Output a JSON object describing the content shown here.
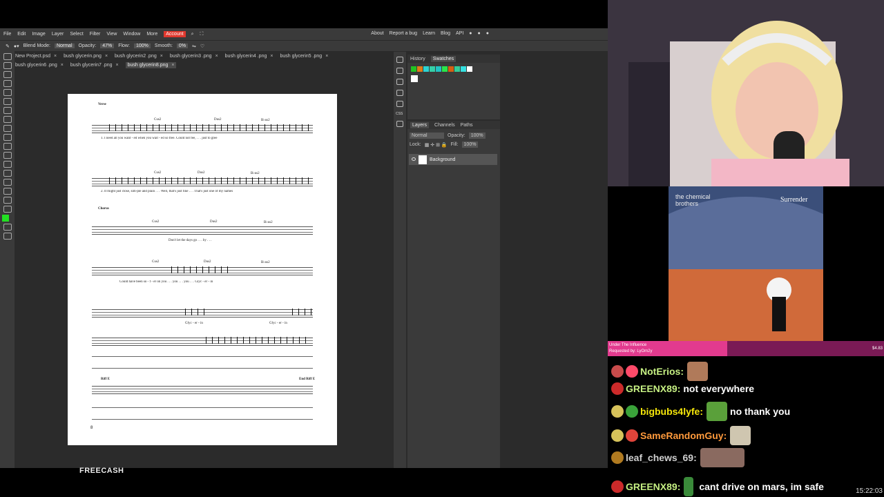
{
  "menubar": {
    "items": [
      "File",
      "Edit",
      "Image",
      "Layer",
      "Select",
      "Filter",
      "View",
      "Window",
      "More"
    ],
    "account": "Account",
    "right_items": [
      "About",
      "Report a bug",
      "Learn",
      "Blog",
      "API"
    ]
  },
  "options": {
    "blend_mode_label": "Blend Mode:",
    "blend_mode_value": "Normal",
    "opacity_label": "Opacity:",
    "opacity_value": "47%",
    "flow_label": "Flow:",
    "flow_value": "100%",
    "smooth_label": "Smooth:",
    "smooth_value": "0%"
  },
  "tabs": {
    "row1": [
      "New Project.psd",
      "bush glycerin.png",
      "bush glycerin2 .png",
      "bush glycerin3 .png",
      "bush glycerin4 .png",
      "bush glycerin5 .png"
    ],
    "row2": [
      "bush glycerin6 .png",
      "bush glycerin7 .png",
      "bush glycerin8.png"
    ],
    "close": "×"
  },
  "sheet": {
    "verse": "Verse",
    "chorus": "Chorus",
    "chords1": [
      "Cus2",
      "Dus2",
      "B♭us2"
    ],
    "lyric1": "1. I need all you want - ed   when you wait - ed   so   free.   Could not   fee, . . .   just   to   gree",
    "lyric2": "2. It might just   close, sim-ple and plain . . .   Well, that's just   fine . . .   That's just one of my   names",
    "lyric3": "Don't let   the   days   go . . .   by . . .",
    "lyric4": "Could have been   so   -   f   -   er   on   you . . .   you . . .   you . . .   Glyc - er - in",
    "lyric5": "Glyc - er - in",
    "riff_a": "Riff E",
    "riff_b": "End Riff E",
    "page_number": "8"
  },
  "panels": {
    "history": "History",
    "swatches": "Swatches",
    "layers": "Layers",
    "channels": "Channels",
    "paths": "Paths",
    "layer_blend": "Normal",
    "layer_opacity_label": "Opacity:",
    "layer_opacity": "100%",
    "lock_label": "Lock:",
    "fill_label": "Fill:",
    "fill_value": "100%",
    "layer_name": "Background",
    "css_label": "CSS"
  },
  "swatch_colors": [
    "#22c322",
    "#e07b19",
    "#2bd3d3",
    "#34d0a8",
    "#22c3c3",
    "#2ae64a",
    "#d55e12",
    "#33cc99",
    "#35e0e0",
    "#ffffff"
  ],
  "freecash": "FREECASH",
  "album": {
    "band": "the chemical brothers",
    "title": "Surrender"
  },
  "now_playing": {
    "song": "Under The Influence",
    "requested": "Requested by: LyOm2y",
    "amount": "$4.83"
  },
  "chat": [
    {
      "user": "NotErios:",
      "text": "",
      "color": "#c6f083"
    },
    {
      "user": "GREENX89:",
      "text": "not everywhere",
      "color": "#c6f083"
    },
    {
      "user": "bigbubs4lyfe:",
      "text": "no thank you",
      "color": "#f5e60a"
    },
    {
      "user": "SameRandomGuy:",
      "text": "",
      "color": "#ff9a3c"
    },
    {
      "user": "leaf_chews_69:",
      "text": "",
      "color": "#cfcfcf"
    },
    {
      "user": "GREENX89:",
      "text": "cant drive on mars, im safe",
      "color": "#c6f083"
    }
  ],
  "clock": "15:22:03"
}
